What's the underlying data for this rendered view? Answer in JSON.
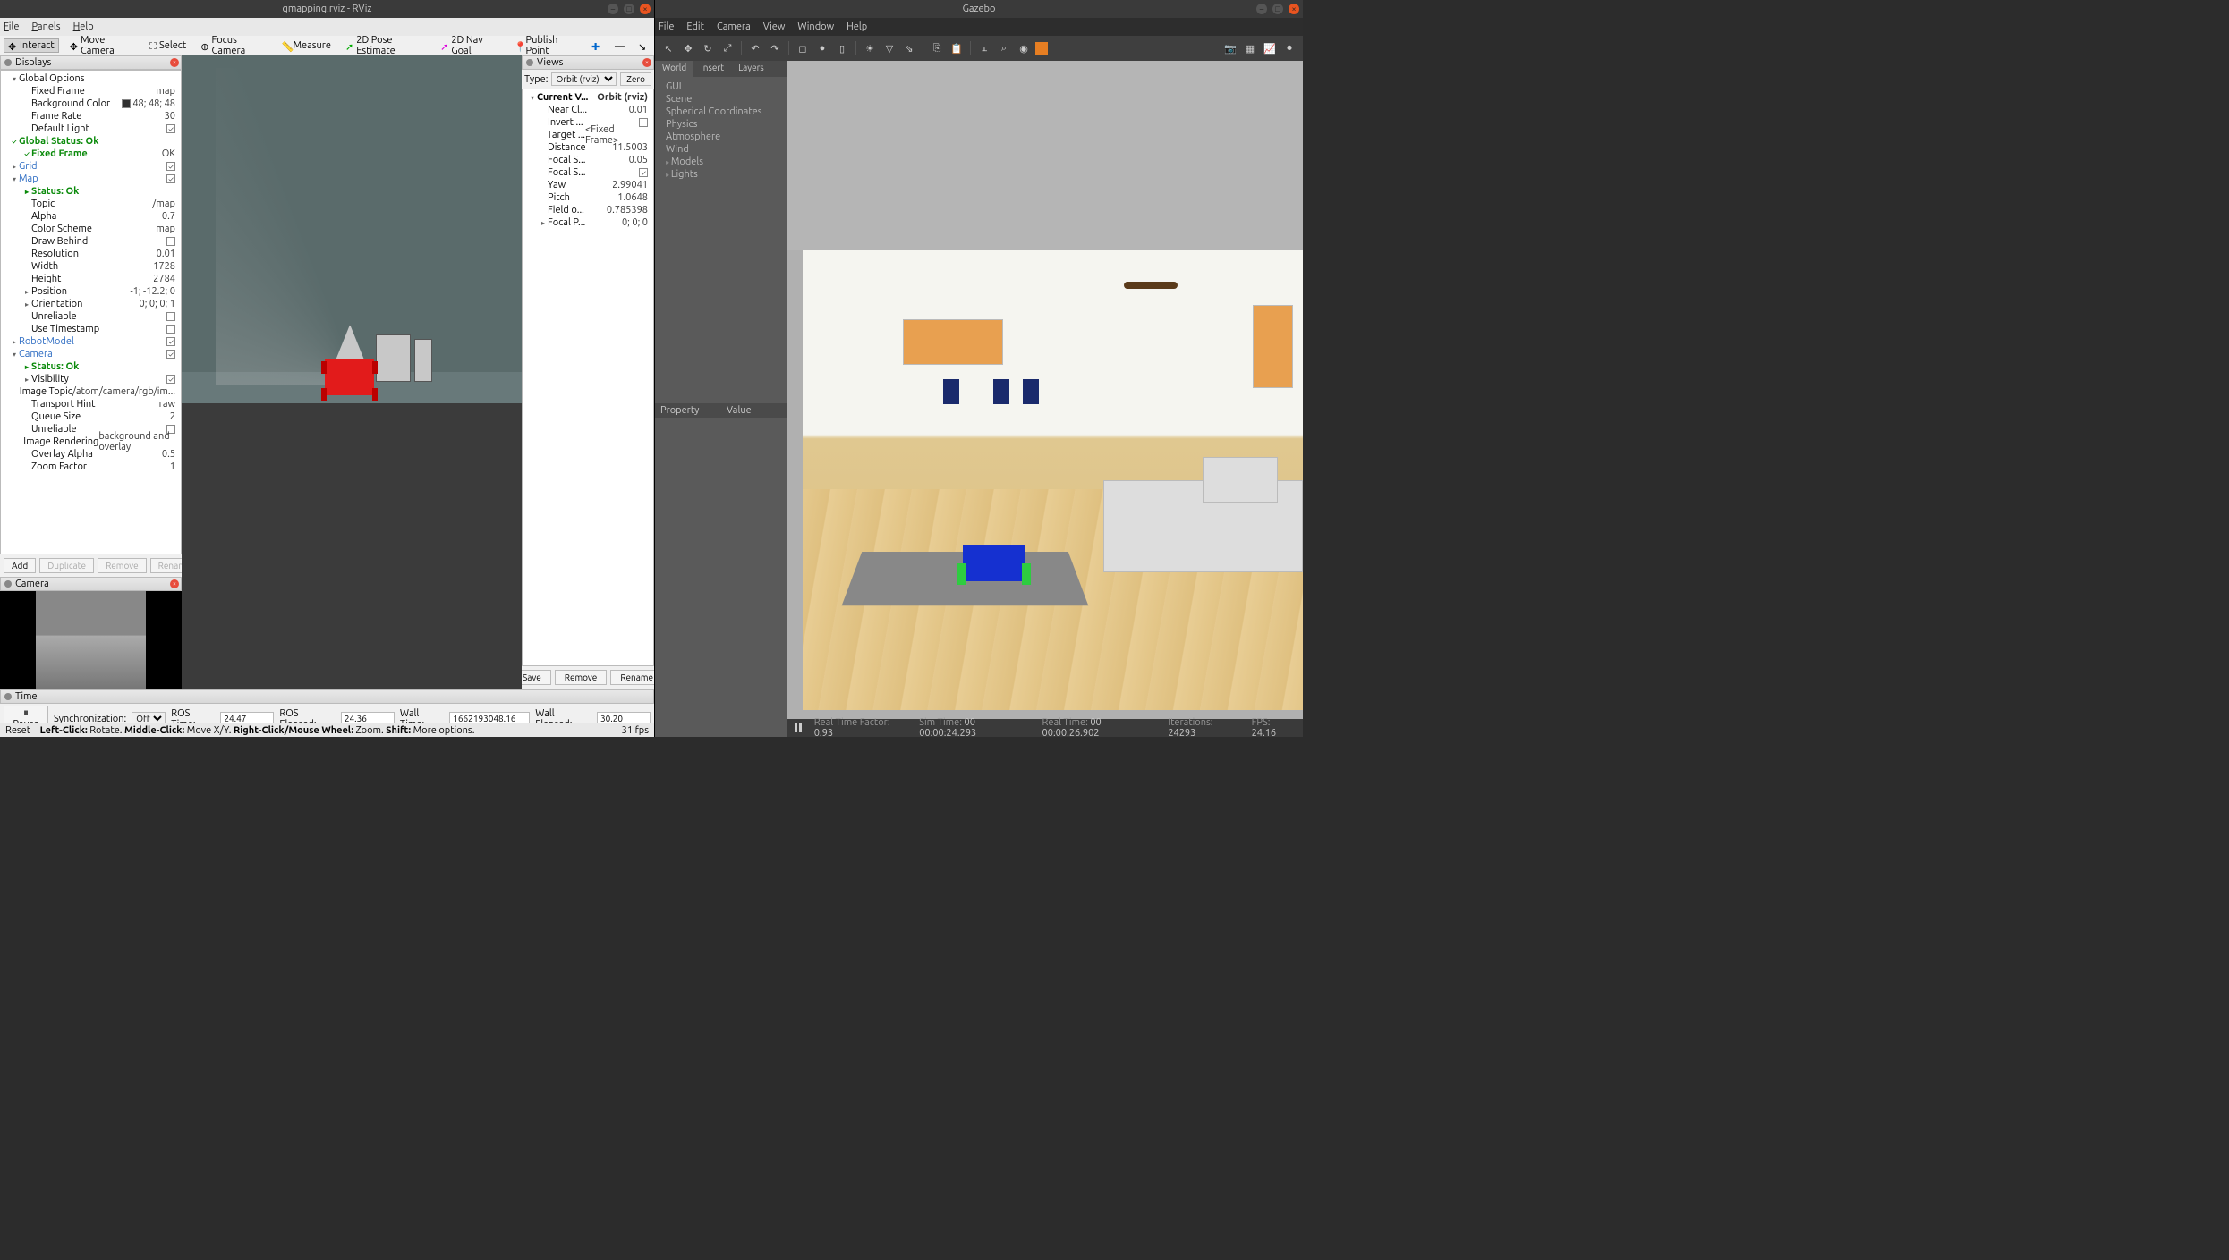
{
  "rviz": {
    "title": "gmapping.rviz - RViz",
    "menu": [
      "File",
      "Panels",
      "Help"
    ],
    "toolbar": [
      {
        "label": "Interact",
        "active": true
      },
      {
        "label": "Move Camera"
      },
      {
        "label": "Select"
      },
      {
        "label": "Focus Camera"
      },
      {
        "label": "Measure"
      },
      {
        "label": "2D Pose Estimate"
      },
      {
        "label": "2D Nav Goal"
      },
      {
        "label": "Publish Point"
      }
    ],
    "displays_title": "Displays",
    "displays_tree": [
      {
        "indent": 0,
        "toggle": "▾",
        "icon": "globe",
        "label": "Global Options",
        "value": "",
        "link": false
      },
      {
        "indent": 1,
        "label": "Fixed Frame",
        "value": "map"
      },
      {
        "indent": 1,
        "label": "Background Color",
        "value": "48; 48; 48",
        "color": "#303030"
      },
      {
        "indent": 1,
        "label": "Frame Rate",
        "value": "30"
      },
      {
        "indent": 1,
        "label": "Default Light",
        "check": true
      },
      {
        "indent": 0,
        "toggle": "✓",
        "label": "Global Status: Ok",
        "status": true
      },
      {
        "indent": 1,
        "toggle": "✓",
        "label": "Fixed Frame",
        "value": "OK",
        "status": true
      },
      {
        "indent": 0,
        "toggle": "▸",
        "icon": "grid",
        "label": "Grid",
        "check": true,
        "link": true
      },
      {
        "indent": 0,
        "toggle": "▾",
        "icon": "map",
        "label": "Map",
        "check": true,
        "link": true
      },
      {
        "indent": 1,
        "toggle": "▸",
        "label": "Status: Ok",
        "status": true
      },
      {
        "indent": 1,
        "label": "Topic",
        "value": "/map"
      },
      {
        "indent": 1,
        "label": "Alpha",
        "value": "0.7"
      },
      {
        "indent": 1,
        "label": "Color Scheme",
        "value": "map"
      },
      {
        "indent": 1,
        "label": "Draw Behind",
        "check": false
      },
      {
        "indent": 1,
        "label": "Resolution",
        "value": "0.01"
      },
      {
        "indent": 1,
        "label": "Width",
        "value": "1728"
      },
      {
        "indent": 1,
        "label": "Height",
        "value": "2784"
      },
      {
        "indent": 1,
        "toggle": "▸",
        "label": "Position",
        "value": "-1; -12.2; 0"
      },
      {
        "indent": 1,
        "toggle": "▸",
        "label": "Orientation",
        "value": "0; 0; 0; 1"
      },
      {
        "indent": 1,
        "label": "Unreliable",
        "check": false
      },
      {
        "indent": 1,
        "label": "Use Timestamp",
        "check": false
      },
      {
        "indent": 0,
        "toggle": "▸",
        "icon": "robot",
        "label": "RobotModel",
        "check": true,
        "link": true
      },
      {
        "indent": 0,
        "toggle": "▾",
        "icon": "camera",
        "label": "Camera",
        "check": true,
        "link": true
      },
      {
        "indent": 1,
        "toggle": "▸",
        "label": "Status: Ok",
        "status": true
      },
      {
        "indent": 1,
        "toggle": "▸",
        "label": "Visibility",
        "check": true
      },
      {
        "indent": 1,
        "label": "Image Topic",
        "value": "/atom/camera/rgb/im..."
      },
      {
        "indent": 1,
        "label": "Transport Hint",
        "value": "raw"
      },
      {
        "indent": 1,
        "label": "Queue Size",
        "value": "2"
      },
      {
        "indent": 1,
        "label": "Unreliable",
        "check": false
      },
      {
        "indent": 1,
        "label": "Image Rendering",
        "value": "background and overlay"
      },
      {
        "indent": 1,
        "label": "Overlay Alpha",
        "value": "0.5"
      },
      {
        "indent": 1,
        "label": "Zoom Factor",
        "value": "1"
      }
    ],
    "displays_buttons": {
      "add": "Add",
      "duplicate": "Duplicate",
      "remove": "Remove",
      "rename": "Rename"
    },
    "camera_title": "Camera",
    "views_title": "Views",
    "views_type_label": "Type:",
    "views_type_value": "Orbit (rviz)",
    "views_zero": "Zero",
    "views_tree": [
      {
        "indent": 0,
        "toggle": "▾",
        "label": "Current V...",
        "value": "Orbit (rviz)",
        "bold": true
      },
      {
        "indent": 1,
        "label": "Near Cl...",
        "value": "0.01"
      },
      {
        "indent": 1,
        "label": "Invert ...",
        "check": false
      },
      {
        "indent": 1,
        "label": "Target ...",
        "value": "<Fixed Frame>"
      },
      {
        "indent": 1,
        "label": "Distance",
        "value": "11.5003"
      },
      {
        "indent": 1,
        "label": "Focal S...",
        "value": "0.05"
      },
      {
        "indent": 1,
        "label": "Focal S...",
        "check": true
      },
      {
        "indent": 1,
        "label": "Yaw",
        "value": "2.99041"
      },
      {
        "indent": 1,
        "label": "Pitch",
        "value": "1.0648"
      },
      {
        "indent": 1,
        "label": "Field o...",
        "value": "0.785398"
      },
      {
        "indent": 1,
        "toggle": "▸",
        "label": "Focal P...",
        "value": "0; 0; 0"
      }
    ],
    "views_buttons": {
      "save": "Save",
      "remove": "Remove",
      "rename": "Rename"
    },
    "time_title": "Time",
    "time": {
      "pause": "Pause",
      "sync_label": "Synchronization:",
      "sync_value": "Off",
      "ros_time_label": "ROS Time:",
      "ros_time": "24.47",
      "ros_elapsed_label": "ROS Elapsed:",
      "ros_elapsed": "24.36",
      "wall_time_label": "Wall Time:",
      "wall_time": "1662193048.16",
      "wall_elapsed_label": "Wall Elapsed:",
      "wall_elapsed": "30.20"
    },
    "status": {
      "reset": "Reset",
      "hint": "Left-Click: Rotate. Middle-Click: Move X/Y. Right-Click/Mouse Wheel: Zoom. Shift: More options.",
      "fps": "31 fps"
    }
  },
  "gazebo": {
    "title": "Gazebo",
    "menu": [
      "File",
      "Edit",
      "Camera",
      "View",
      "Window",
      "Help"
    ],
    "tabs": [
      "World",
      "Insert",
      "Layers"
    ],
    "world_tree": [
      "GUI",
      "Scene",
      "Spherical Coordinates",
      "Physics",
      "Atmosphere",
      "Wind",
      "Models",
      "Lights"
    ],
    "prop_headers": [
      "Property",
      "Value"
    ],
    "bottom": {
      "rtf_label": "Real Time Factor:",
      "rtf": "0.93",
      "sim_label": "Sim Time:",
      "sim": "00 00:00:24.293",
      "real_label": "Real Time:",
      "real": "00 00:00:26.902",
      "iter_label": "Iterations:",
      "iter": "24293",
      "fps_label": "FPS:",
      "fps": "24.16"
    }
  }
}
